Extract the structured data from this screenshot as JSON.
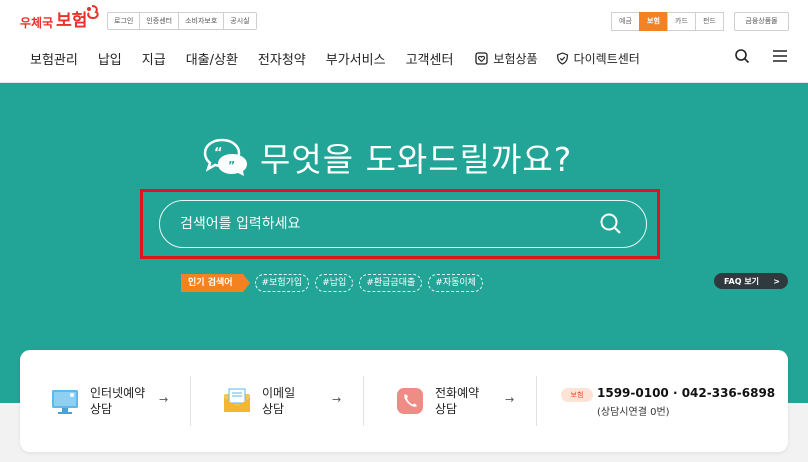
{
  "header": {
    "logo_small": "우체국",
    "logo_big": "보험",
    "util_links": [
      "로그인",
      "인증센터",
      "소비자보호",
      "공시실"
    ],
    "biz_tabs": [
      {
        "label": "예금",
        "active": false
      },
      {
        "label": "보험",
        "active": true
      },
      {
        "label": "카드",
        "active": false
      },
      {
        "label": "펀드",
        "active": false
      }
    ],
    "fin_product": "금융상품몰",
    "gnb": [
      "보험관리",
      "납입",
      "지급",
      "대출/상환",
      "전자청약",
      "부가서비스",
      "고객센터"
    ],
    "gnb_extra": [
      {
        "label": "보험상품",
        "icon": "heart-box-icon"
      },
      {
        "label": "다이렉트센터",
        "icon": "shield-check-icon"
      }
    ]
  },
  "hero": {
    "title": "무엇을 도와드릴까요?",
    "search_placeholder": "검색어를 입력하세요",
    "popular_label": "인기 검색어",
    "tags": [
      "#보험가입",
      "#납입",
      "#환급금대출",
      "#자동이체"
    ],
    "faq_label": "FAQ 보기",
    "faq_arrow": ">"
  },
  "services": [
    {
      "line1": "인터넷예약",
      "line2": "상담",
      "icon": "monitor-icon"
    },
    {
      "line1": "이메일",
      "line2": "상담",
      "icon": "mail-icon"
    },
    {
      "line1": "전화예약",
      "line2": "상담",
      "icon": "phone-icon"
    }
  ],
  "phone": {
    "badge": "보험",
    "number": "1599-0100 · 042-336-6898",
    "sub": "(상담시연결 0번)"
  },
  "colors": {
    "brand_red": "#e8322b",
    "teal": "#22a597",
    "orange": "#f58220",
    "highlight_red": "#e0141e"
  }
}
